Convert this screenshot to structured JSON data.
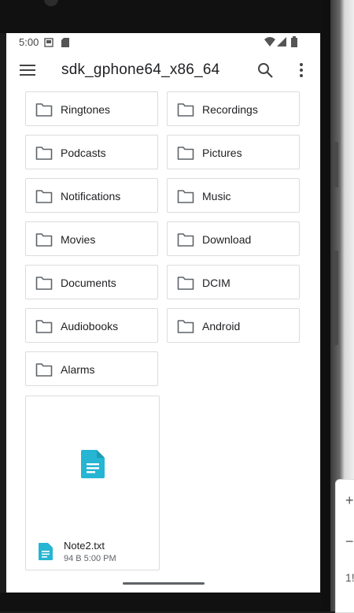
{
  "status_bar": {
    "time": "5:00"
  },
  "app_bar": {
    "title": "sdk_gphone64_x86_64"
  },
  "folders": [
    {
      "label": "Ringtones"
    },
    {
      "label": "Recordings"
    },
    {
      "label": "Podcasts"
    },
    {
      "label": "Pictures"
    },
    {
      "label": "Notifications"
    },
    {
      "label": "Music"
    },
    {
      "label": "Movies"
    },
    {
      "label": "Download"
    },
    {
      "label": "Documents"
    },
    {
      "label": "DCIM"
    },
    {
      "label": "Audiobooks"
    },
    {
      "label": "Android"
    },
    {
      "label": "Alarms"
    }
  ],
  "file": {
    "name": "Note2.txt",
    "meta": "94 B  5:00 PM",
    "icon": "document-icon",
    "accent": "#26b5d3"
  },
  "colors": {
    "text": "#202124",
    "icon": "#5f6368",
    "border": "#dadce0"
  }
}
